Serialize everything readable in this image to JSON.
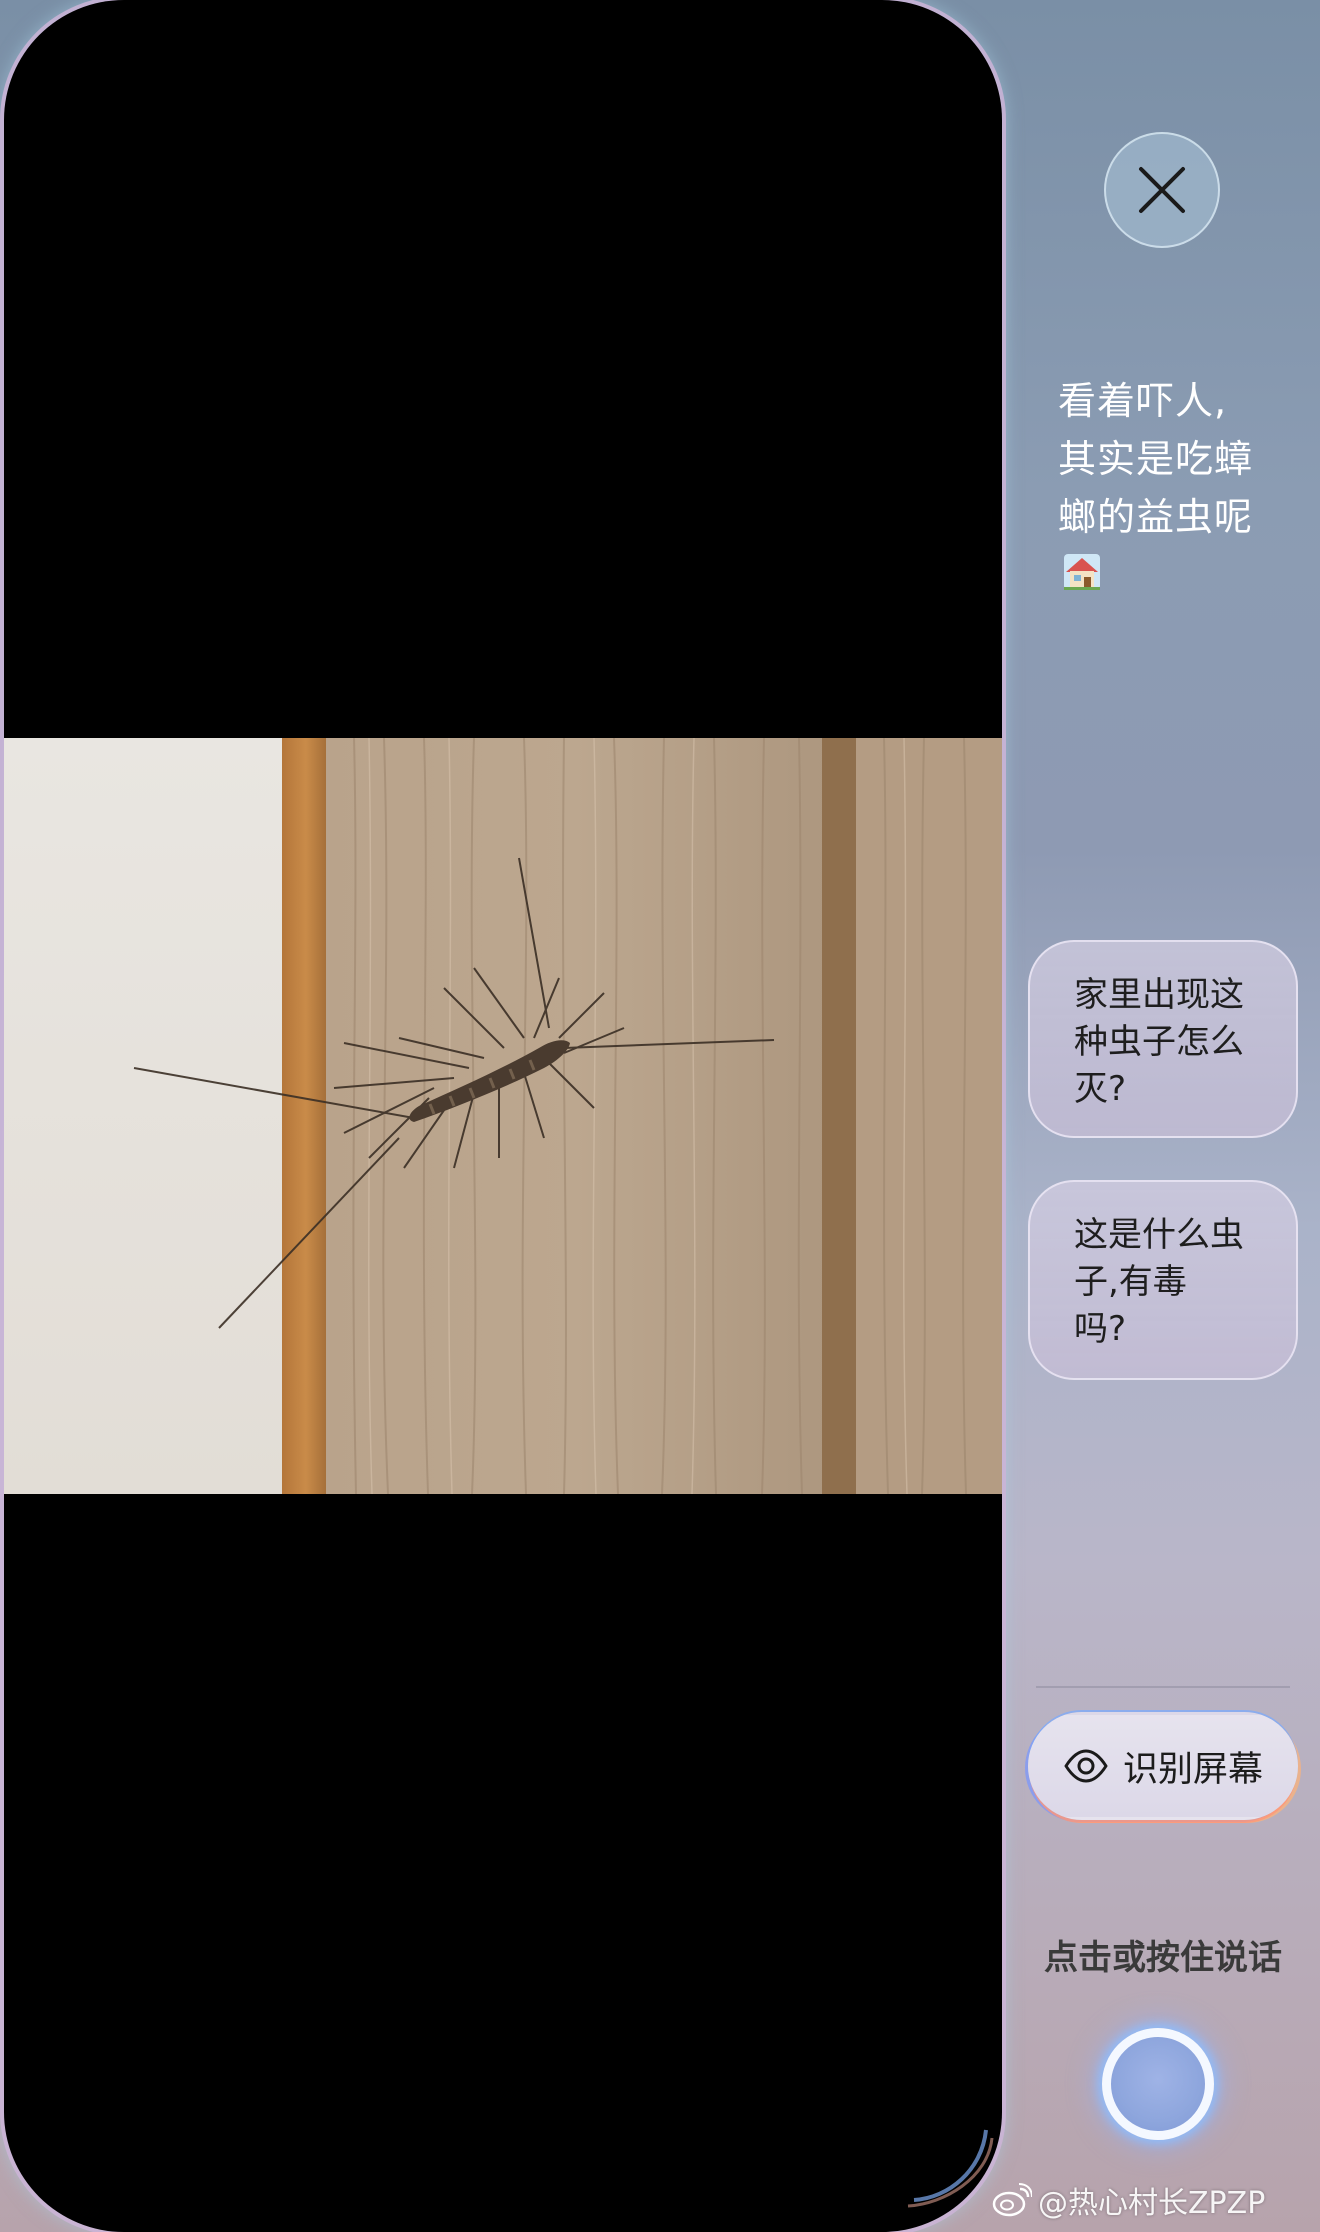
{
  "close_button": {
    "icon": "close-icon"
  },
  "assistant_hint": {
    "lines": [
      "看着吓人,",
      "其实是吃蟑",
      "螂的益虫呢"
    ],
    "emoji": "house-emoji"
  },
  "suggestions": [
    {
      "lines": [
        "家里出现这",
        "种虫子怎么",
        "灭?"
      ]
    },
    {
      "lines": [
        "这是什么虫",
        "子,有毒",
        "吗?"
      ]
    }
  ],
  "screen_recognition": {
    "label": "识别屏幕",
    "icon": "eye-icon"
  },
  "voice": {
    "hint": "点击或按住说话",
    "icon": "microphone-orb-icon"
  },
  "watermark": {
    "text": "@热心村长ZPZP",
    "icon": "weibo-logo"
  },
  "photo": {
    "subject": "house-centipede-on-wood-door"
  }
}
